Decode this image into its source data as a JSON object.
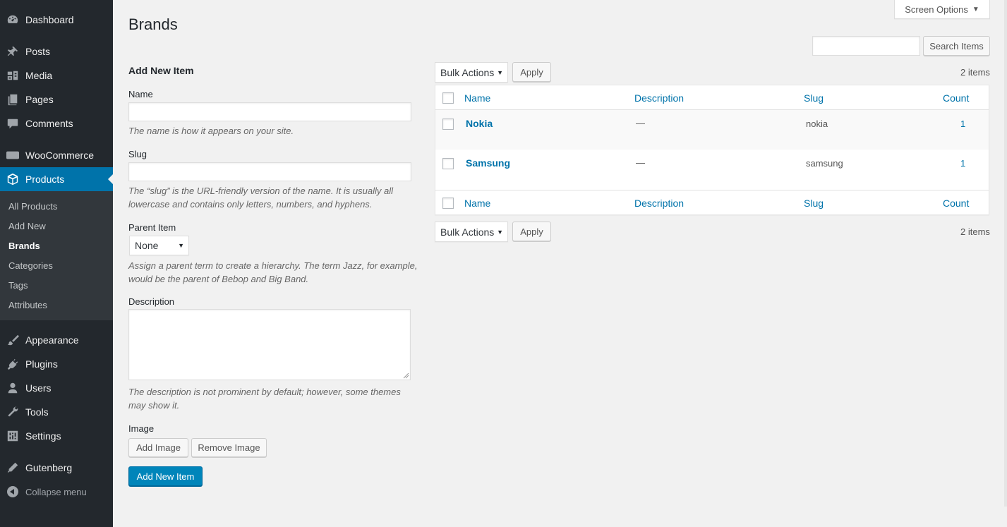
{
  "sidebar": {
    "menu": [
      {
        "label": "Dashboard",
        "icon": "dashboard-icon"
      },
      {
        "label": "Posts",
        "icon": "pin-icon"
      },
      {
        "label": "Media",
        "icon": "media-icon"
      },
      {
        "label": "Pages",
        "icon": "pages-icon"
      },
      {
        "label": "Comments",
        "icon": "comment-icon"
      },
      {
        "label": "WooCommerce",
        "icon": "woo-icon"
      },
      {
        "label": "Products",
        "icon": "box-icon"
      },
      {
        "label": "Appearance",
        "icon": "brush-icon"
      },
      {
        "label": "Plugins",
        "icon": "plug-icon"
      },
      {
        "label": "Users",
        "icon": "user-icon"
      },
      {
        "label": "Tools",
        "icon": "wrench-icon"
      },
      {
        "label": "Settings",
        "icon": "settings-icon"
      },
      {
        "label": "Gutenberg",
        "icon": "pen-icon"
      }
    ],
    "woo_badge": "woo",
    "submenu": [
      "All Products",
      "Add New",
      "Brands",
      "Categories",
      "Tags",
      "Attributes"
    ],
    "collapse_label": "Collapse menu"
  },
  "header": {
    "title": "Brands",
    "screen_options": "Screen Options",
    "search_button": "Search Items",
    "search_value": ""
  },
  "form": {
    "heading": "Add New Item",
    "name_label": "Name",
    "name_value": "",
    "name_help": "The name is how it appears on your site.",
    "slug_label": "Slug",
    "slug_value": "",
    "slug_help": "The “slug” is the URL-friendly version of the name. It is usually all lowercase and contains only letters, numbers, and hyphens.",
    "parent_label": "Parent Item",
    "parent_value": "None",
    "parent_help": "Assign a parent term to create a hierarchy. The term Jazz, for example, would be the parent of Bebop and Big Band.",
    "description_label": "Description",
    "description_value": "",
    "description_help": "The description is not prominent by default; however, some themes may show it.",
    "image_label": "Image",
    "add_image": "Add Image",
    "remove_image": "Remove Image",
    "submit": "Add New Item"
  },
  "list": {
    "bulk_actions": "Bulk Actions",
    "apply": "Apply",
    "items_count": "2 items",
    "columns": [
      "Name",
      "Description",
      "Slug",
      "Count"
    ],
    "rows": [
      {
        "name": "Nokia",
        "description": "—",
        "slug": "nokia",
        "count": "1"
      },
      {
        "name": "Samsung",
        "description": "—",
        "slug": "samsung",
        "count": "1"
      }
    ]
  },
  "colors": {
    "sidebar_bg": "#23282d",
    "submenu_bg": "#32373c",
    "accent": "#0073aa",
    "primary_button": "#0085ba",
    "page_bg": "#f1f1f1"
  }
}
